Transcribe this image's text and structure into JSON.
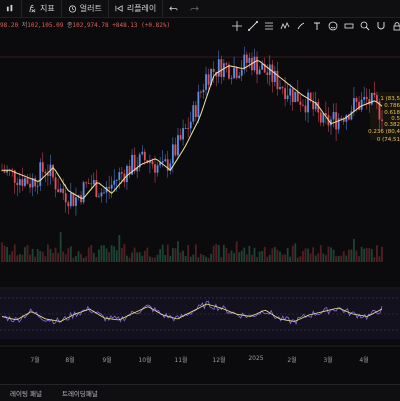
{
  "toolbar": {
    "items": [
      {
        "label": "",
        "icon": "chart-type-icon"
      },
      {
        "label": "지표",
        "icon": "function-icon"
      },
      {
        "label": "얼러트",
        "icon": "alert-clock-icon"
      },
      {
        "label": "리플레이",
        "icon": "replay-icon"
      }
    ],
    "undo_icon": "undo-icon",
    "redo_icon": "redo-icon"
  },
  "legend": {
    "prefix": "98.20",
    "h_label": "저",
    "low": "102,105.09",
    "c_label": "종",
    "close": "102,974.78",
    "change": "+848.13",
    "change_pct": "(+0.82%)"
  },
  "fib_levels": [
    "1 (83,5",
    "0.786",
    "0.618",
    "0.5",
    "0.382",
    "0.236 (80,4",
    "0 (74,51"
  ],
  "x_axis_labels": [
    "7월",
    "8월",
    "9월",
    "10월",
    "11월",
    "12월",
    "2025",
    "2월",
    "3월",
    "4월"
  ],
  "bottom_bar": {
    "left": "레이팅 패널",
    "right": "트레이딩패널"
  },
  "colors": {
    "bull": "#5b8fe6",
    "bear": "#e0505a",
    "ma": "#f3e6a0",
    "rsi": "#8a6fe0",
    "rsi_ma": "#f0e68c",
    "fib": "#e7c24d",
    "background": "#0b0b0d"
  },
  "chart_data": {
    "type": "line",
    "price_series_name": "",
    "price_trend": [
      62,
      60,
      58,
      63,
      55,
      52,
      58,
      54,
      60,
      64,
      66,
      62,
      70,
      80,
      95,
      98,
      97,
      100,
      96,
      92,
      88,
      85,
      78,
      80,
      84,
      86,
      82
    ],
    "rsi_trend": [
      45,
      38,
      55,
      40,
      35,
      50,
      60,
      42,
      38,
      52,
      65,
      48,
      40,
      55,
      70,
      62,
      50,
      45,
      58,
      40,
      35,
      48,
      55,
      62,
      50,
      45,
      60
    ]
  }
}
